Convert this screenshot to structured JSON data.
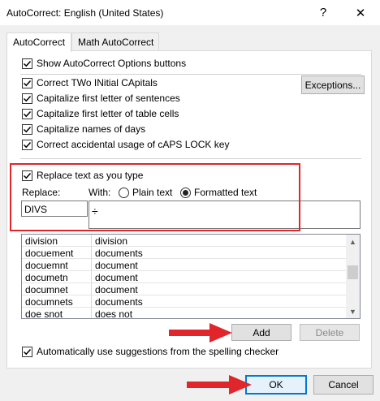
{
  "window": {
    "title": "AutoCorrect: English (United States)",
    "help_glyph": "?",
    "close_glyph": "✕"
  },
  "tabs": [
    {
      "label": "AutoCorrect",
      "active": true
    },
    {
      "label": "Math AutoCorrect",
      "active": false
    }
  ],
  "options": {
    "show_buttons": "Show AutoCorrect Options buttons",
    "two_initials": "Correct TWo INitial CApitals",
    "first_sentence": "Capitalize first letter of sentences",
    "first_table_cell": "Capitalize first letter of table cells",
    "days": "Capitalize names of days",
    "caps_lock": "Correct accidental usage of cAPS LOCK key",
    "replace_as_type": "Replace text as you type",
    "auto_suggest": "Automatically use suggestions from the spelling checker"
  },
  "exceptions_label": "Exceptions...",
  "replace": {
    "replace_label": "Replace:",
    "with_label": "With:",
    "plain_text": "Plain text",
    "formatted_text": "Formatted text",
    "selected": "formatted",
    "replace_value": "DIVS",
    "with_value": "÷"
  },
  "entries": [
    {
      "from": "division",
      "to": "division"
    },
    {
      "from": "docuement",
      "to": "documents"
    },
    {
      "from": "docuemnt",
      "to": "document"
    },
    {
      "from": "documetn",
      "to": "document"
    },
    {
      "from": "documnet",
      "to": "document"
    },
    {
      "from": "documnets",
      "to": "documents"
    },
    {
      "from": "doe snot",
      "to": "does not"
    }
  ],
  "buttons": {
    "add": "Add",
    "delete": "Delete",
    "ok": "OK",
    "cancel": "Cancel"
  },
  "colors": {
    "highlight": "#e0252b",
    "accent": "#0078d7"
  }
}
